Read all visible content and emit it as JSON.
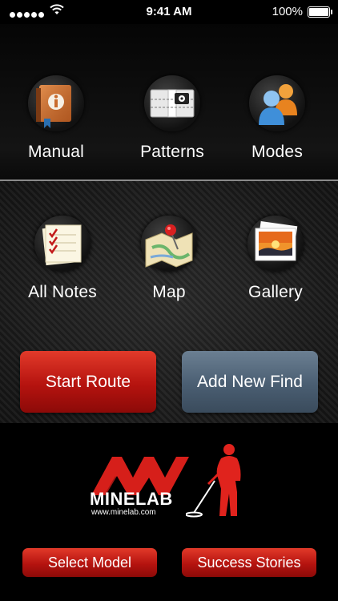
{
  "status": {
    "time": "9:41 AM",
    "battery": "100%"
  },
  "top_row": [
    {
      "label": "Manual",
      "icon": "manual-book-icon"
    },
    {
      "label": "Patterns",
      "icon": "patterns-icon"
    },
    {
      "label": "Modes",
      "icon": "modes-users-icon"
    }
  ],
  "mid_row": [
    {
      "label": "All Notes",
      "icon": "notes-icon"
    },
    {
      "label": "Map",
      "icon": "map-pin-icon"
    },
    {
      "label": "Gallery",
      "icon": "gallery-photos-icon"
    }
  ],
  "actions": {
    "start_route": "Start Route",
    "add_new_find": "Add New Find"
  },
  "brand": {
    "name": "MINELAB",
    "url": "www.minelab.com"
  },
  "bottom": {
    "select_model": "Select Model",
    "success_stories": "Success Stories"
  },
  "colors": {
    "accent_red": "#c81b14",
    "slate": "#52667a"
  }
}
